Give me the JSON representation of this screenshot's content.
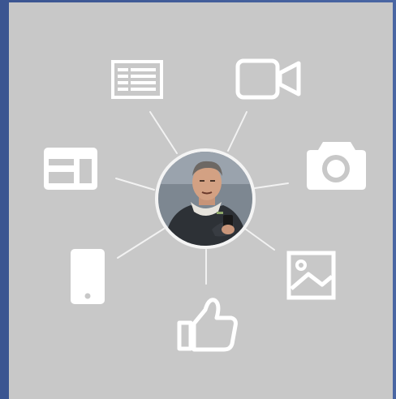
{
  "colors": {
    "panel": "#c8c8c8",
    "frame": "#4a66a3",
    "icon": "#ffffff",
    "connector": "#f2f2f2"
  },
  "center": {
    "icon": "user-photo-avatar"
  },
  "nodes": [
    {
      "id": "article",
      "icon": "article-icon"
    },
    {
      "id": "video",
      "icon": "video-camera-icon"
    },
    {
      "id": "layout",
      "icon": "layout-icon"
    },
    {
      "id": "photo",
      "icon": "camera-icon"
    },
    {
      "id": "mobile",
      "icon": "mobile-phone-icon"
    },
    {
      "id": "image",
      "icon": "image-icon"
    },
    {
      "id": "like",
      "icon": "thumbs-up-icon"
    }
  ]
}
